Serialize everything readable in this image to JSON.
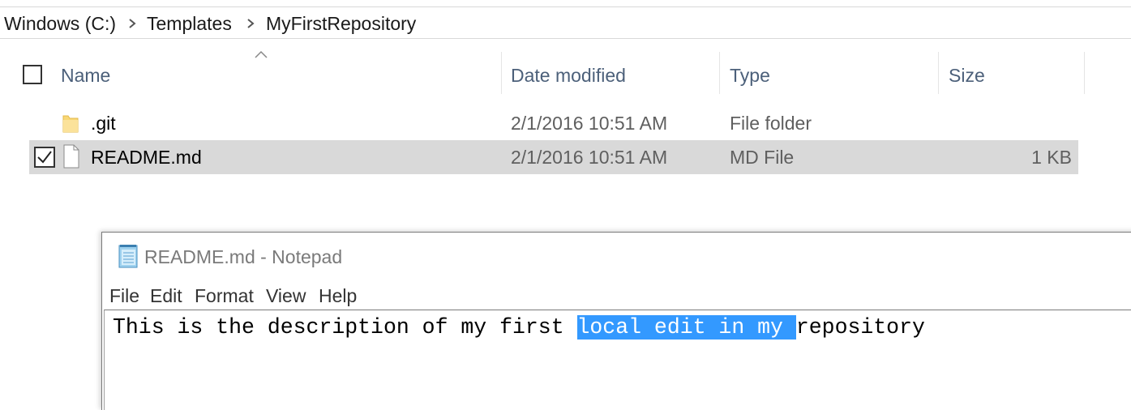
{
  "breadcrumb": {
    "items": [
      "Windows (C:)",
      "Templates",
      "MyFirstRepository"
    ]
  },
  "columns": {
    "name": "Name",
    "date_modified": "Date modified",
    "type": "Type",
    "size": "Size"
  },
  "files": [
    {
      "name": ".git",
      "date_modified": "2/1/2016 10:51 AM",
      "type": "File folder",
      "size": "",
      "icon": "folder-icon",
      "selected": false
    },
    {
      "name": "README.md",
      "date_modified": "2/1/2016 10:51 AM",
      "type": "MD File",
      "size": "1 KB",
      "icon": "file-icon",
      "selected": true,
      "checked": true
    }
  ],
  "notepad": {
    "title": "README.md - Notepad",
    "menu": [
      "File",
      "Edit",
      "Format",
      "View",
      "Help"
    ],
    "content": {
      "before": "This is the description of my first ",
      "selected": "local edit in my ",
      "after": "repository"
    }
  },
  "colors": {
    "selection_highlight": "#3399ff",
    "row_selected": "#d9d9d9",
    "header_text": "#4c607a",
    "folder": "#f8d775"
  }
}
